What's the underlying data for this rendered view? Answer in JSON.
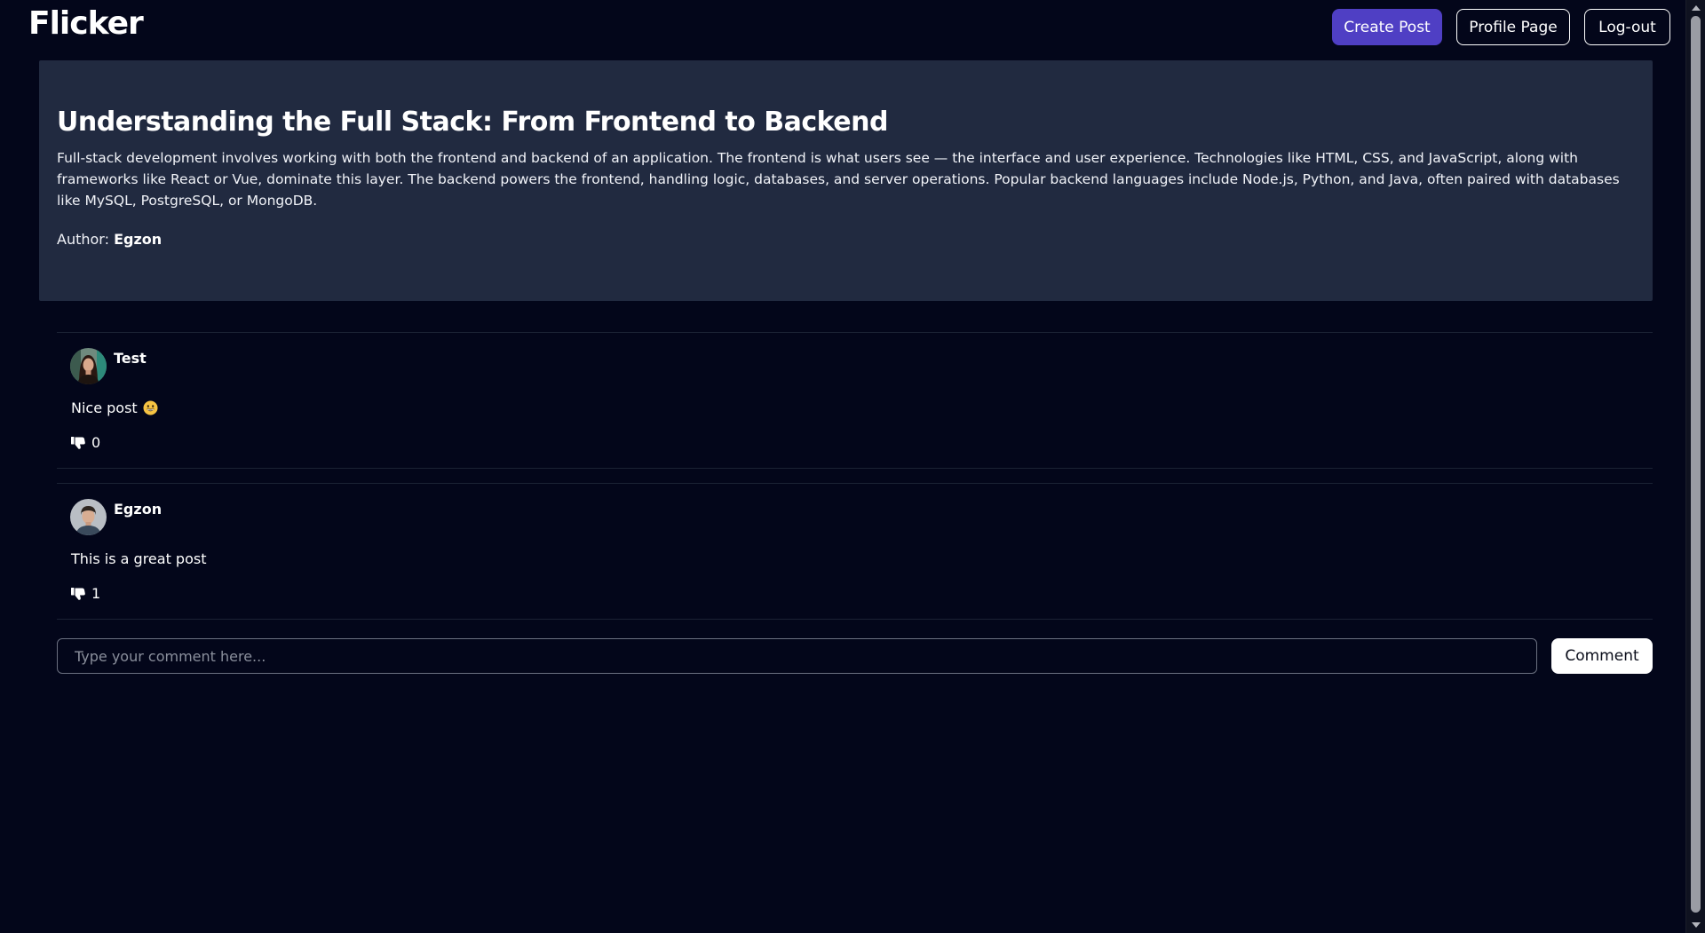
{
  "app": {
    "logo": "Flicker"
  },
  "header": {
    "create_post_label": "Create Post",
    "profile_page_label": "Profile Page",
    "logout_label": "Log-out"
  },
  "post": {
    "title": "Understanding the Full Stack: From Frontend to Backend",
    "body": "Full-stack development involves working with both the frontend and backend of an application. The frontend is what users see — the interface and user experience. Technologies like HTML, CSS, and JavaScript, along with frameworks like React or Vue, dominate this layer. The backend powers the frontend, handling logic, databases, and server operations. Popular backend languages include Node.js, Python, and Java, often paired with databases like MySQL, PostgreSQL, or MongoDB.",
    "author_label": "Author:",
    "author_name": "Egzon"
  },
  "comments": [
    {
      "user": "Test",
      "text": "Nice post",
      "emoji": "grinning-face-emoji",
      "likes": "0",
      "avatar": "female-avatar"
    },
    {
      "user": "Egzon",
      "text": "This is a great post",
      "likes": "1",
      "avatar": "male-avatar"
    }
  ],
  "comment_form": {
    "placeholder": "Type your comment here...",
    "submit_label": "Comment"
  },
  "colors": {
    "background": "#03061a",
    "card": "#212a40",
    "accent": "#4f3fc4",
    "text": "#ffffff"
  },
  "icons": {
    "like": "thumbs-down-icon"
  }
}
